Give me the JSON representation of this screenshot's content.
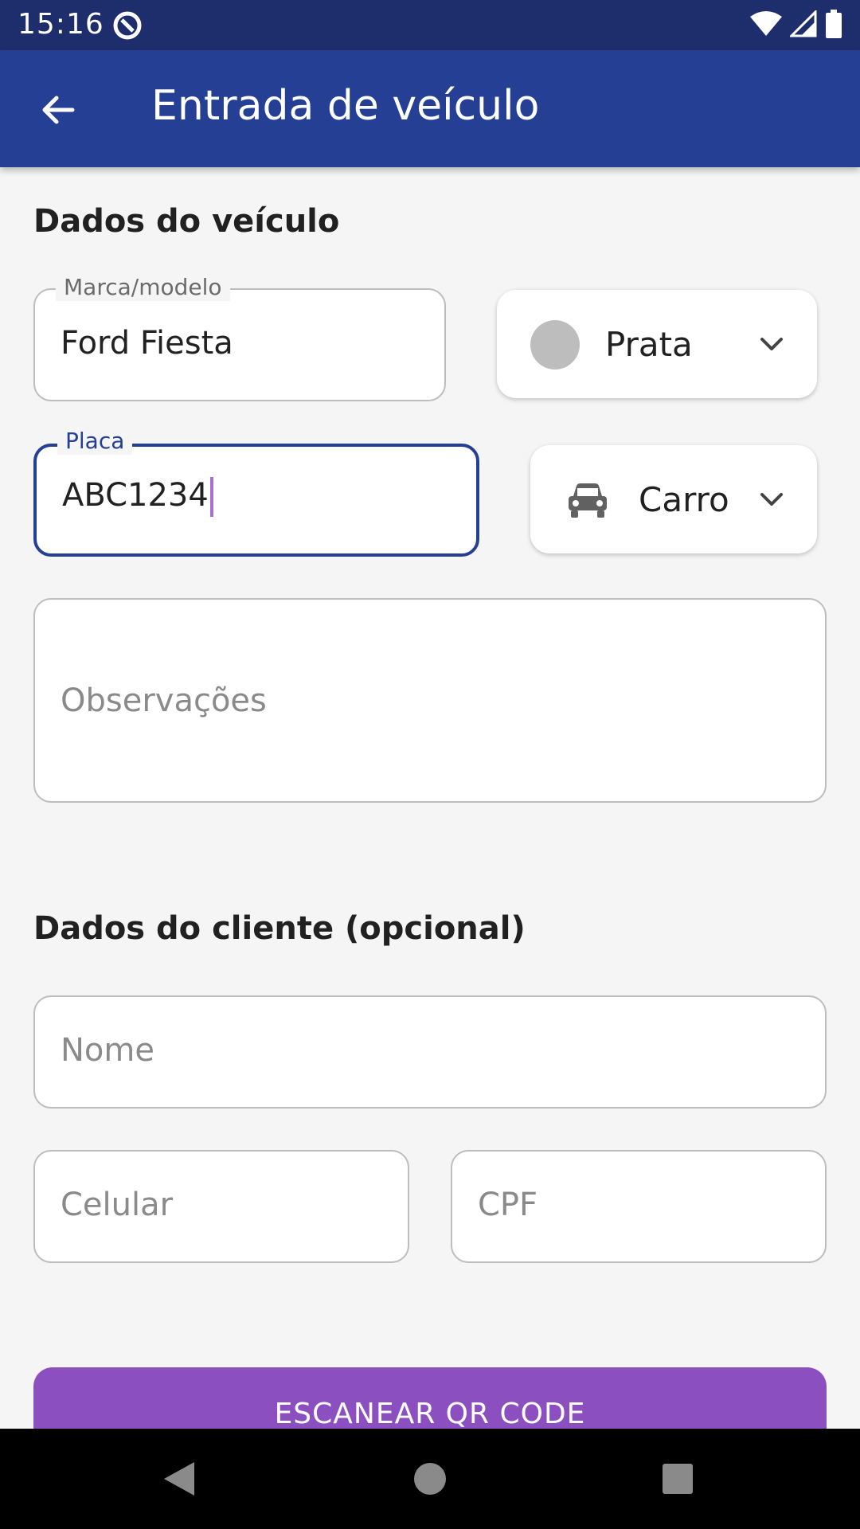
{
  "status_bar": {
    "time": "15:16"
  },
  "app_bar": {
    "title": "Entrada de veículo"
  },
  "vehicle_section": {
    "title": "Dados do veículo",
    "brand_model": {
      "label": "Marca/modelo",
      "value": "Ford Fiesta"
    },
    "color_select": {
      "value": "Prata",
      "swatch_color": "#bdbdbd"
    },
    "plate": {
      "label": "Placa",
      "value": "ABC1234"
    },
    "type_select": {
      "value": "Carro",
      "icon": "car-icon"
    },
    "notes": {
      "placeholder": "Observações"
    }
  },
  "client_section": {
    "title": "Dados do cliente (opcional)",
    "name": {
      "placeholder": "Nome"
    },
    "phone": {
      "placeholder": "Celular"
    },
    "cpf": {
      "placeholder": "CPF"
    }
  },
  "actions": {
    "scan_qr_label": "ESCANEAR QR CODE"
  },
  "colors": {
    "status_bar": "#1e2d6b",
    "app_bar": "#243f93",
    "button": "#8b4fc0",
    "background": "#f5f5f5"
  }
}
